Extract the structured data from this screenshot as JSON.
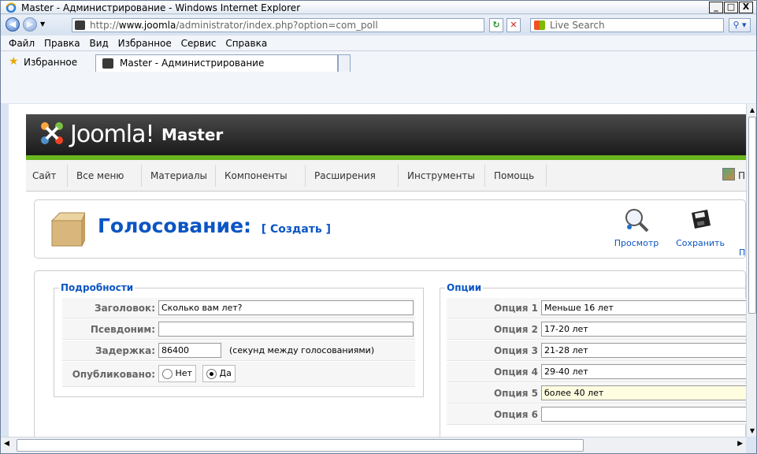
{
  "window": {
    "title": "Master - Администрирование - Windows Internet Explorer",
    "minimize": "_",
    "maximize": "□",
    "close": "X"
  },
  "address": {
    "url_prefix": "http://",
    "url_host": "www.joomla",
    "url_path": "/administrator/index.php?option=com_poll",
    "search_placeholder": "Live Search"
  },
  "menubar": {
    "items": [
      "Файл",
      "Правка",
      "Вид",
      "Избранное",
      "Сервис",
      "Справка"
    ]
  },
  "favorites": {
    "label": "Избранное",
    "tab_title": "Master - Администрирование"
  },
  "joomla": {
    "brand": "Joomla!",
    "site_name": "Master"
  },
  "nav": {
    "items": [
      "Сайт",
      "Все меню",
      "Материалы",
      "Компоненты",
      "Расширения",
      "Инструменты",
      "Помощь"
    ],
    "right_label": "П"
  },
  "toolbar": {
    "title": "Голосование:",
    "subtitle": "[ Создать ]",
    "preview_label": "Просмотр",
    "save_label": "Сохранить",
    "cut_label": "П"
  },
  "details": {
    "legend": "Подробности",
    "title_label": "Заголовок:",
    "title_value": "Сколько вам лет?",
    "alias_label": "Псевдоним:",
    "alias_value": "",
    "lag_label": "Задержка:",
    "lag_value": "86400",
    "lag_hint": "(секунд между голосованиями)",
    "published_label": "Опубликовано:",
    "published_no": "Нет",
    "published_yes": "Да",
    "published_selected": "yes"
  },
  "options": {
    "legend": "Опции",
    "items": [
      {
        "label": "Опция 1",
        "value": "Меньше 16 лет"
      },
      {
        "label": "Опция 2",
        "value": "17-20 лет"
      },
      {
        "label": "Опция 3",
        "value": "21-28 лет"
      },
      {
        "label": "Опция 4",
        "value": "29-40 лет"
      },
      {
        "label": "Опция 5",
        "value": "более 40 лет"
      },
      {
        "label": "Опция 6",
        "value": ""
      }
    ]
  },
  "colors": {
    "accent": "#0b55c4",
    "joomla_green": "#6ab51e",
    "focus_field": "#fffde0"
  }
}
